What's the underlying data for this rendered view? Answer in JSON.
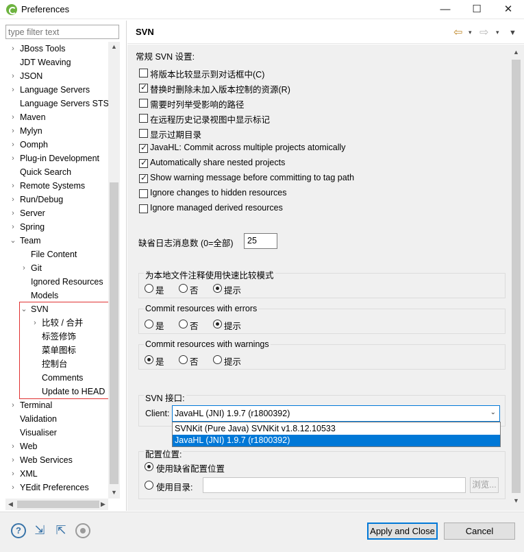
{
  "window": {
    "title": "Preferences",
    "minimize": "—",
    "maximize": "☐",
    "close": "✕"
  },
  "filter": {
    "placeholder": "type filter text"
  },
  "tree": [
    {
      "label": "JBoss Tools",
      "arrow": "›"
    },
    {
      "label": "JDT Weaving",
      "arrow": ""
    },
    {
      "label": "JSON",
      "arrow": "›"
    },
    {
      "label": "Language Servers",
      "arrow": "›"
    },
    {
      "label": "Language Servers STS",
      "arrow": ""
    },
    {
      "label": "Maven",
      "arrow": "›"
    },
    {
      "label": "Mylyn",
      "arrow": "›"
    },
    {
      "label": "Oomph",
      "arrow": "›"
    },
    {
      "label": "Plug-in Development",
      "arrow": "›"
    },
    {
      "label": "Quick Search",
      "arrow": ""
    },
    {
      "label": "Remote Systems",
      "arrow": "›"
    },
    {
      "label": "Run/Debug",
      "arrow": "›"
    },
    {
      "label": "Server",
      "arrow": "›"
    },
    {
      "label": "Spring",
      "arrow": "›"
    },
    {
      "label": "Team",
      "arrow": "⌄"
    },
    {
      "label": "File Content",
      "arrow": ""
    },
    {
      "label": "Git",
      "arrow": "›"
    },
    {
      "label": "Ignored Resources",
      "arrow": ""
    },
    {
      "label": "Models",
      "arrow": ""
    },
    {
      "label": "SVN",
      "arrow": "⌄"
    },
    {
      "label": "比较 / 合并",
      "arrow": "›"
    },
    {
      "label": "标签修饰",
      "arrow": ""
    },
    {
      "label": "菜单图标",
      "arrow": ""
    },
    {
      "label": "控制台",
      "arrow": ""
    },
    {
      "label": "Comments",
      "arrow": ""
    },
    {
      "label": "Update to HEAD",
      "arrow": ""
    },
    {
      "label": "Terminal",
      "arrow": "›"
    },
    {
      "label": "Validation",
      "arrow": ""
    },
    {
      "label": "Visualiser",
      "arrow": ""
    },
    {
      "label": "Web",
      "arrow": "›"
    },
    {
      "label": "Web Services",
      "arrow": "›"
    },
    {
      "label": "XML",
      "arrow": "›"
    },
    {
      "label": "YEdit Preferences",
      "arrow": "›"
    }
  ],
  "page": {
    "title": "SVN",
    "back_icon": "⇦",
    "forward_icon": "⇨",
    "dropdown_icon": "▾",
    "menu_icon": "▼"
  },
  "general": {
    "heading": "常规 SVN 设置:",
    "options": [
      {
        "label": "将版本比较显示到对话框中(C)",
        "checked": false
      },
      {
        "label": "替换时删除未加入版本控制的资源(R)",
        "checked": true
      },
      {
        "label": "需要时列举受影响的路径",
        "checked": false
      },
      {
        "label": "在远程历史记录视图中显示标记",
        "checked": false
      },
      {
        "label": "显示过期目录",
        "checked": false
      },
      {
        "label": "JavaHL: Commit across multiple projects atomically",
        "checked": true
      },
      {
        "label": "Automatically share nested projects",
        "checked": true
      },
      {
        "label": "Show warning message before committing to tag path",
        "checked": true
      },
      {
        "label": "Ignore changes to hidden resources",
        "checked": false
      },
      {
        "label": "Ignore managed derived resources",
        "checked": false
      }
    ]
  },
  "log_messages": {
    "label": "缺省日志消息数 (0=全部)",
    "value": "25"
  },
  "groups": [
    {
      "title": "为本地文件注释使用快速比较模式",
      "options": [
        "是",
        "否",
        "提示"
      ],
      "selected": 2
    },
    {
      "title": "Commit resources with errors",
      "options": [
        "是",
        "否",
        "提示"
      ],
      "selected": 2
    },
    {
      "title": "Commit resources with warnings",
      "options": [
        "是",
        "否",
        "提示"
      ],
      "selected": 0
    }
  ],
  "svn_interface": {
    "title": "SVN 接口:",
    "client_label": "Client:",
    "client_value": "JavaHL (JNI) 1.9.7 (r1800392)",
    "options": [
      "SVNKit (Pure Java) SVNKit v1.8.12.10533",
      "JavaHL (JNI) 1.9.7 (r1800392)"
    ],
    "selected_option": 1
  },
  "config_location": {
    "title": "配置位置:",
    "default_label": "使用缺省配置位置",
    "dir_label": "使用目录:",
    "dir_value": "",
    "browse_label": "浏览..."
  },
  "footer": {
    "apply_close": "Apply and Close",
    "cancel": "Cancel",
    "help_icon": "?"
  },
  "colors": {
    "accent": "#0078d7",
    "highlight_box": "#e03030",
    "selected_bg": "#0078d7"
  }
}
